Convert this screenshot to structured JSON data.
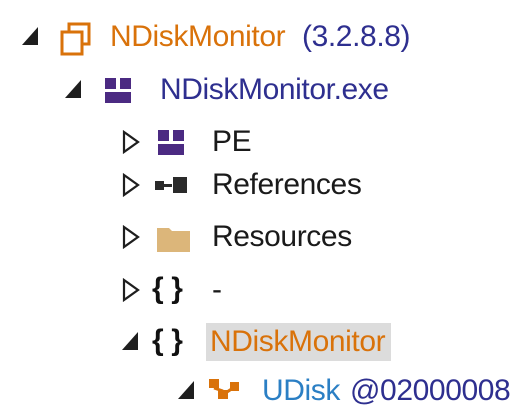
{
  "tree": {
    "assembly": {
      "name": "NDiskMonitor",
      "version": "(3.2.8.8)",
      "icon": "assembly-icon",
      "expanded": true
    },
    "module": {
      "name": "NDiskMonitor.exe",
      "icon": "module-icon",
      "expanded": true
    },
    "children": [
      {
        "label": "PE",
        "icon": "pe-icon",
        "expanded": false
      },
      {
        "label": "References",
        "icon": "references-icon",
        "expanded": false
      },
      {
        "label": "Resources",
        "icon": "folder-icon",
        "expanded": false
      },
      {
        "label": "-",
        "icon": "namespace-icon",
        "expanded": false
      },
      {
        "label": "NDiskMonitor",
        "icon": "namespace-icon",
        "expanded": true,
        "selected": true
      }
    ],
    "type": {
      "name": "UDisk",
      "token": "@02000008",
      "icon": "class-icon",
      "expanded": true
    }
  },
  "colors": {
    "assembly": "#d9720a",
    "module": "#2e2f8f",
    "type": "#2b7fc4",
    "text": "#111111",
    "selection": "#dcdcdc"
  }
}
